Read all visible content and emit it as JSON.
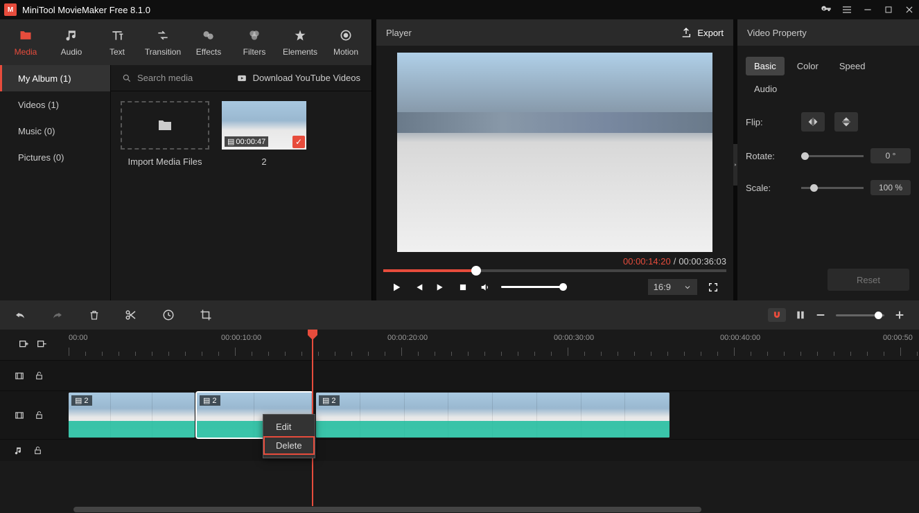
{
  "titlebar": {
    "title": "MiniTool MovieMaker Free 8.1.0"
  },
  "topTabs": {
    "media": "Media",
    "audio": "Audio",
    "text": "Text",
    "transition": "Transition",
    "effects": "Effects",
    "filters": "Filters",
    "elements": "Elements",
    "motion": "Motion"
  },
  "sidebar": {
    "myAlbum": "My Album (1)",
    "videos": "Videos (1)",
    "music": "Music (0)",
    "pictures": "Pictures (0)"
  },
  "mediaBar": {
    "searchPlaceholder": "Search media",
    "youtube": "Download YouTube Videos"
  },
  "importLabel": "Import Media Files",
  "thumb": {
    "duration": "00:00:47",
    "name": "2"
  },
  "player": {
    "title": "Player",
    "export": "Export",
    "curr": "00:00:14:20",
    "total": "00:00:36:03",
    "aspect": "16:9"
  },
  "property": {
    "title": "Video Property",
    "tabs": {
      "basic": "Basic",
      "color": "Color",
      "speed": "Speed",
      "audio": "Audio"
    },
    "flip": "Flip:",
    "rotate": "Rotate:",
    "rotateVal": "0 °",
    "scale": "Scale:",
    "scaleVal": "100 %",
    "reset": "Reset"
  },
  "ruler": {
    "t0": "00:00",
    "t1": "00:00:10:00",
    "t2": "00:00:20:00",
    "t3": "00:00:30:00",
    "t4": "00:00:40:00",
    "t5": "00:00:50"
  },
  "clip": {
    "label": "2"
  },
  "contextMenu": {
    "edit": "Edit",
    "delete": "Delete"
  }
}
